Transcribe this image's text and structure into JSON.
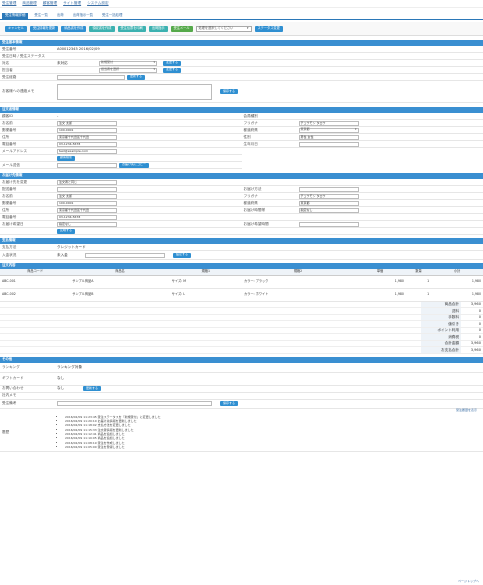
{
  "topnav": [
    "受注管理",
    "商品管理",
    "顧客管理",
    "サイト管理",
    "システム設定"
  ],
  "subtabs": [
    {
      "label": "受注情報詳細",
      "active": true
    },
    {
      "label": "受注一覧",
      "active": false
    },
    {
      "label": "出荷",
      "active": false
    },
    {
      "label": "出荷指示一覧",
      "active": false
    },
    {
      "label": "受注一括処理",
      "active": false
    }
  ],
  "actions": {
    "buttons": [
      "キャンセル",
      "受注情報を更新",
      "納品書を作成",
      "領収書を作成",
      "受注伝票を印刷",
      "出荷指示",
      "受注メール"
    ],
    "select_value": "処理を選択してください",
    "run_label": "ステータス変更"
  },
  "order_basic": {
    "title": "受注基本情報",
    "rows": [
      {
        "label": "受注番号",
        "value": "A00012345  2016/02/09"
      },
      {
        "label": "受注日時 / 受注ステータス",
        "value": ""
      },
      {
        "label": "対応",
        "value": "未対応"
      },
      {
        "label": "担当者",
        "value": ""
      },
      {
        "label": "受注経路",
        "value": ""
      },
      {
        "label": "お客様への連絡メモ",
        "value": ""
      }
    ],
    "status_select": "新規受付",
    "staff_select": "担当者を選択",
    "change_label": "変更する",
    "update_label": "更新する",
    "save_label": "保存する"
  },
  "customer": {
    "title": "注文者情報",
    "left": [
      {
        "label": "顧客ID",
        "value": "-"
      },
      {
        "label": "お名前",
        "value": "注文 太郎"
      },
      {
        "label": "郵便番号",
        "value": "100-0001"
      },
      {
        "label": "住所",
        "value": "東京都千代田区千代田"
      },
      {
        "label": "電話番号",
        "value": "03-1234-5678"
      },
      {
        "label": "メールアドレス",
        "value": "test@example.com"
      }
    ],
    "right": [
      {
        "label": "会員種別",
        "value": ""
      },
      {
        "label": "フリガナ",
        "value": "チュウモン タロウ"
      },
      {
        "label": "都道府県",
        "value": "東京都"
      },
      {
        "label": "性別",
        "value": "男性 女性"
      },
      {
        "label": "生年月日",
        "value": ""
      },
      {
        "label": "",
        "value": ""
      }
    ],
    "search_label": "顧客検索",
    "mail_label": "メール送信",
    "copy_label": "お届け先にコピー"
  },
  "shipping": {
    "title": "お届け先情報",
    "rows_left": [
      {
        "label": "お届け先を変更",
        "value": "注文者と同じ"
      },
      {
        "label": "配送番号",
        "value": ""
      },
      {
        "label": "お名前",
        "value": "注文 太郎"
      },
      {
        "label": "郵便番号",
        "value": "100-0001"
      },
      {
        "label": "住所",
        "value": "東京都千代田区千代田"
      },
      {
        "label": "電話番号",
        "value": "03-1234-5678"
      },
      {
        "label": "お届け希望日",
        "value": "指定なし"
      }
    ],
    "rows_right": [
      {
        "label": "",
        "value": ""
      },
      {
        "label": "お届け方法",
        "value": ""
      },
      {
        "label": "フリガナ",
        "value": "チュウモン タロウ"
      },
      {
        "label": "都道府県",
        "value": "東京都"
      },
      {
        "label": "お届け時間帯",
        "value": "指定なし"
      },
      {
        "label": "",
        "value": ""
      },
      {
        "label": "お届け希望時間",
        "value": ""
      }
    ],
    "apply_label": "反映する"
  },
  "payment": {
    "title": "支払情報",
    "rows": [
      {
        "label": "支払方法",
        "value": "クレジットカード"
      },
      {
        "label": "入金状況",
        "value": "未入金"
      }
    ],
    "set_label": "設定する"
  },
  "items": {
    "title": "注文内容",
    "headers": [
      "商品コード",
      "商品名",
      "規格1",
      "規格2",
      "単価",
      "数量",
      "小計"
    ],
    "rows": [
      {
        "code": "ABC-001",
        "name": "サンプル商品A",
        "spec1": "サイズ: M",
        "spec2": "カラー: ブラック",
        "price": "1,980",
        "qty": "1",
        "subtotal": "1,980"
      },
      {
        "code": "ABC-002",
        "name": "サンプル商品B",
        "spec1": "サイズ: L",
        "spec2": "カラー: ホワイト",
        "price": "1,980",
        "qty": "1",
        "subtotal": "1,980"
      }
    ],
    "summary": [
      {
        "label": "商品合計",
        "value": "3,960"
      },
      {
        "label": "送料",
        "value": "0"
      },
      {
        "label": "手数料",
        "value": "0"
      },
      {
        "label": "値引き",
        "value": "0"
      },
      {
        "label": "ポイント利用",
        "value": "0"
      },
      {
        "label": "消費税",
        "value": "0"
      },
      {
        "label": "合計金額",
        "value": "3,960"
      },
      {
        "label": "お支払合計",
        "value": "3,960"
      }
    ]
  },
  "other": {
    "title": "その他",
    "rows": [
      {
        "label": "ランキング",
        "value": "ランキング対象"
      },
      {
        "label": "ギフトカード",
        "value": "なし"
      },
      {
        "label": "お問い合わせ",
        "value": "なし"
      },
      {
        "label": "社内メモ",
        "value": ""
      },
      {
        "label": "受注備考",
        "value": ""
      }
    ],
    "update_label": "更新する",
    "memo_save": "保存する",
    "history_label": "履歴",
    "history_link": "受注履歴を表示",
    "history": [
      "2016/02/09 11:23:45 受注ステータスを「新規受付」に変更しました",
      "2016/02/09 11:20:10 お届け先情報を更新しました",
      "2016/02/09 11:18:02 支払方法を変更しました",
      "2016/02/09 11:15:33 注文者情報を更新しました",
      "2016/02/09 11:12:41 商品を追加しました",
      "2016/02/09 11:10:05 商品を追加しました",
      "2016/02/09 11:08:19 受注を作成しました",
      "2016/02/09 11:05:00 受注を登録しました"
    ]
  },
  "footer": "ページトップへ"
}
